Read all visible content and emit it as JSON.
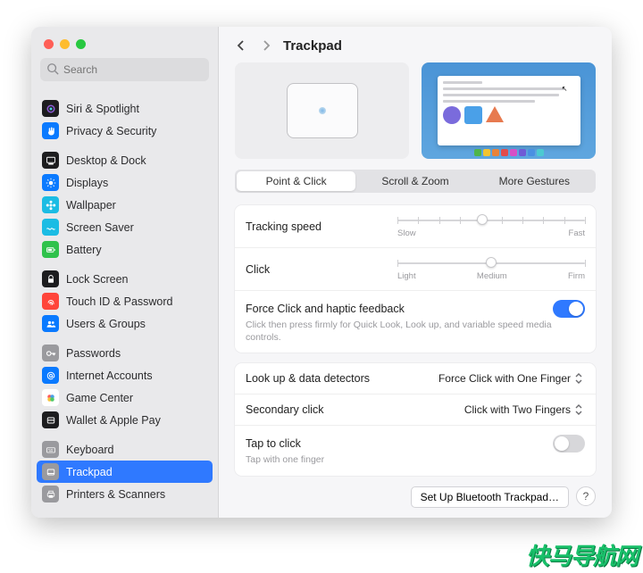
{
  "window_title": "Trackpad",
  "search_placeholder": "Search",
  "sidebar_groups": [
    [
      {
        "label": "Siri & Spotlight",
        "icon": "siri",
        "bg": "#1d1d1f"
      },
      {
        "label": "Privacy & Security",
        "icon": "hand",
        "bg": "#0a7aff"
      }
    ],
    [
      {
        "label": "Desktop & Dock",
        "icon": "dock",
        "bg": "#1d1d1f"
      },
      {
        "label": "Displays",
        "icon": "sun",
        "bg": "#0a7aff"
      },
      {
        "label": "Wallpaper",
        "icon": "flower",
        "bg": "#1bbce4"
      },
      {
        "label": "Screen Saver",
        "icon": "wave",
        "bg": "#1bbce4"
      },
      {
        "label": "Battery",
        "icon": "battery",
        "bg": "#2fc24b"
      }
    ],
    [
      {
        "label": "Lock Screen",
        "icon": "lock",
        "bg": "#1d1d1f"
      },
      {
        "label": "Touch ID & Password",
        "icon": "finger",
        "bg": "#ff453a"
      },
      {
        "label": "Users & Groups",
        "icon": "users",
        "bg": "#0a7aff"
      }
    ],
    [
      {
        "label": "Passwords",
        "icon": "key",
        "bg": "#9a9a9e"
      },
      {
        "label": "Internet Accounts",
        "icon": "at",
        "bg": "#0a7aff"
      },
      {
        "label": "Game Center",
        "icon": "game",
        "bg": "#fff"
      },
      {
        "label": "Wallet & Apple Pay",
        "icon": "wallet",
        "bg": "#1d1d1f"
      }
    ],
    [
      {
        "label": "Keyboard",
        "icon": "keyboard",
        "bg": "#9a9a9e"
      },
      {
        "label": "Trackpad",
        "icon": "trackpad",
        "bg": "#9a9a9e",
        "sel": true
      },
      {
        "label": "Printers & Scanners",
        "icon": "printer",
        "bg": "#9a9a9e"
      }
    ]
  ],
  "tabs": [
    "Point & Click",
    "Scroll & Zoom",
    "More Gestures"
  ],
  "active_tab": 0,
  "tracking": {
    "label": "Tracking speed",
    "low": "Slow",
    "high": "Fast",
    "ticks": 10,
    "pos": 0.45
  },
  "click": {
    "label": "Click",
    "low": "Light",
    "mid": "Medium",
    "high": "Firm",
    "ticks": 3,
    "pos": 0.5
  },
  "force": {
    "label": "Force Click and haptic feedback",
    "desc": "Click then press firmly for Quick Look, Look up, and variable speed media controls.",
    "on": true
  },
  "lookup": {
    "label": "Look up & data detectors",
    "value": "Force Click with One Finger"
  },
  "secondary": {
    "label": "Secondary click",
    "value": "Click with Two Fingers"
  },
  "tap": {
    "label": "Tap to click",
    "desc": "Tap with one finger",
    "on": false
  },
  "setup_btn": "Set Up Bluetooth Trackpad…",
  "help": "?",
  "dock_colors": [
    "#4fb54a",
    "#f4c430",
    "#e8833a",
    "#e24b4b",
    "#d650c7",
    "#6f5bd6",
    "#4a90e2",
    "#4ccad1"
  ],
  "watermark": "快马导航网"
}
